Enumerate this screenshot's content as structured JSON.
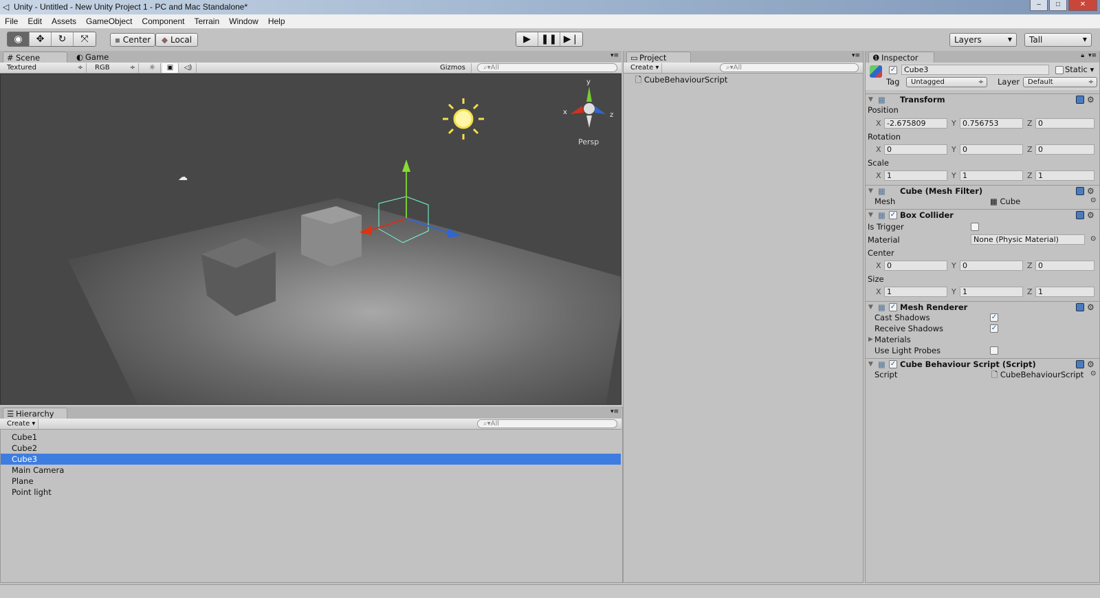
{
  "window": {
    "title": "Unity - Untitled - New Unity Project 1 - PC and Mac Standalone*"
  },
  "menu": [
    "File",
    "Edit",
    "Assets",
    "GameObject",
    "Component",
    "Terrain",
    "Window",
    "Help"
  ],
  "toolbar": {
    "tools": [
      "view-tool",
      "move-tool",
      "rotate-tool",
      "scale-tool"
    ],
    "pivot": "Center",
    "space": "Local",
    "layers": "Layers",
    "layout": "Tall"
  },
  "scene": {
    "tabs": [
      "Scene",
      "Game"
    ],
    "render_mode": "Textured",
    "channel": "RGB",
    "gizmos": "Gizmos",
    "search": "All",
    "persp": "Persp",
    "axes": {
      "x": "x",
      "y": "y",
      "z": "z"
    }
  },
  "hierarchy": {
    "tab": "Hierarchy",
    "create": "Create",
    "search": "All",
    "items": [
      "Cube1",
      "Cube2",
      "Cube3",
      "Main Camera",
      "Plane",
      "Point light"
    ],
    "selected": "Cube3"
  },
  "project": {
    "tab": "Project",
    "create": "Create",
    "search": "All",
    "items": [
      "CubeBehaviourScript"
    ]
  },
  "inspector": {
    "tab": "Inspector",
    "object_name": "Cube3",
    "active": true,
    "static_label": "Static",
    "tag_label": "Tag",
    "tag": "Untagged",
    "layer_label": "Layer",
    "layer": "Default",
    "transform": {
      "title": "Transform",
      "position_label": "Position",
      "position": [
        "-2.675809",
        "0.756753",
        "0"
      ],
      "rotation_label": "Rotation",
      "rotation": [
        "0",
        "0",
        "0"
      ],
      "scale_label": "Scale",
      "scale": [
        "1",
        "1",
        "1"
      ]
    },
    "mesh_filter": {
      "title": "Cube (Mesh Filter)",
      "mesh_label": "Mesh",
      "mesh": "Cube"
    },
    "box_collider": {
      "title": "Box Collider",
      "is_trigger_label": "Is Trigger",
      "is_trigger": false,
      "material_label": "Material",
      "material": "None (Physic Material)",
      "center_label": "Center",
      "center": [
        "0",
        "0",
        "0"
      ],
      "size_label": "Size",
      "size": [
        "1",
        "1",
        "1"
      ]
    },
    "mesh_renderer": {
      "title": "Mesh Renderer",
      "cast_label": "Cast Shadows",
      "cast": true,
      "receive_label": "Receive Shadows",
      "receive": true,
      "materials_label": "Materials",
      "probes_label": "Use Light Probes",
      "probes": false
    },
    "script": {
      "title": "Cube Behaviour Script (Script)",
      "script_label": "Script",
      "script": "CubeBehaviourScript"
    },
    "axis_labels": [
      "X",
      "Y",
      "Z"
    ]
  },
  "colors": {
    "selection": "#3e7de0",
    "panel": "#c2c2c2",
    "viewport": "#4a4a4a"
  }
}
